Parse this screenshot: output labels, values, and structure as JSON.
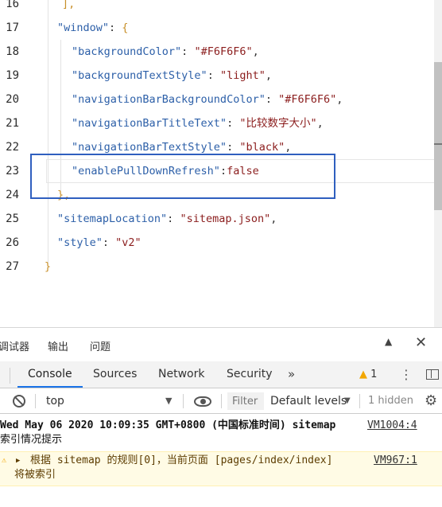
{
  "editor": {
    "lines": [
      {
        "n": "16",
        "tokens": [
          {
            "t": "],",
            "c": "g"
          }
        ]
      },
      {
        "n": "17",
        "tokens": [
          {
            "t": "\"window\"",
            "c": "k"
          },
          {
            "t": ": ",
            "c": "p"
          },
          {
            "t": "{",
            "c": "g"
          }
        ]
      },
      {
        "n": "18",
        "tokens": [
          {
            "t": "\"backgroundColor\"",
            "c": "k"
          },
          {
            "t": ": ",
            "c": "p"
          },
          {
            "t": "\"#F6F6F6\"",
            "c": "s"
          },
          {
            "t": ",",
            "c": "p"
          }
        ]
      },
      {
        "n": "19",
        "tokens": [
          {
            "t": "\"backgroundTextStyle\"",
            "c": "k"
          },
          {
            "t": ": ",
            "c": "p"
          },
          {
            "t": "\"light\"",
            "c": "s"
          },
          {
            "t": ",",
            "c": "p"
          }
        ]
      },
      {
        "n": "20",
        "tokens": [
          {
            "t": "\"navigationBarBackgroundColor\"",
            "c": "k"
          },
          {
            "t": ": ",
            "c": "p"
          },
          {
            "t": "\"#F6F6F6\"",
            "c": "s"
          },
          {
            "t": ",",
            "c": "p"
          }
        ]
      },
      {
        "n": "21",
        "tokens": [
          {
            "t": "\"navigationBarTitleText\"",
            "c": "k"
          },
          {
            "t": ": ",
            "c": "p"
          },
          {
            "t": "\"比较数字大小\"",
            "c": "s"
          },
          {
            "t": ",",
            "c": "p"
          }
        ]
      },
      {
        "n": "22",
        "tokens": [
          {
            "t": "\"navigationBarTextStyle\"",
            "c": "k"
          },
          {
            "t": ": ",
            "c": "p"
          },
          {
            "t": "\"black\"",
            "c": "s"
          },
          {
            "t": ",",
            "c": "p"
          }
        ]
      },
      {
        "n": "23",
        "tokens": [
          {
            "t": "\"enablePullDownRefresh\"",
            "c": "k"
          },
          {
            "t": ":",
            "c": "p"
          },
          {
            "t": "false",
            "c": "s"
          }
        ]
      },
      {
        "n": "24",
        "tokens": [
          {
            "t": "},",
            "c": "g"
          }
        ]
      },
      {
        "n": "25",
        "tokens": [
          {
            "t": "\"sitemapLocation\"",
            "c": "k"
          },
          {
            "t": ": ",
            "c": "p"
          },
          {
            "t": "\"sitemap.json\"",
            "c": "s"
          },
          {
            "t": ",",
            "c": "p"
          }
        ]
      },
      {
        "n": "26",
        "tokens": [
          {
            "t": "\"style\"",
            "c": "k"
          },
          {
            "t": ": ",
            "c": "p"
          },
          {
            "t": "\"v2\"",
            "c": "s"
          }
        ]
      },
      {
        "n": "27",
        "tokens": [
          {
            "t": "}",
            "c": "g"
          }
        ]
      }
    ]
  },
  "panel_tabs": {
    "debugger": "调试器",
    "output": "输出",
    "problems": "问题"
  },
  "devtools": {
    "tabs": {
      "console": "Console",
      "sources": "Sources",
      "network": "Network",
      "security": "Security",
      "more": "»"
    },
    "warning_count": "1",
    "toolbar": {
      "context": "top",
      "filter_placeholder": "Filter",
      "levels": "Default levels",
      "hidden": "1 hidden"
    },
    "log": {
      "line1": "Wed May 06 2020 10:09:35 GMT+0800 (中国标准时间) sitemap",
      "line2": "索引情况提示",
      "source": "VM1004:4"
    },
    "warning": {
      "line1": "根据 sitemap 的规则[0]，当前页面 [pages/index/index]",
      "line2": "将被索引",
      "source": "VM967:1"
    }
  },
  "colors": {
    "key": "#2c5fa8",
    "string": "#8b1d1d",
    "bracket": "#c8902a",
    "highlight_box": "#2f5fbf",
    "console_tab_accent": "#1a73e8",
    "warning_bg": "#fffbe5"
  }
}
